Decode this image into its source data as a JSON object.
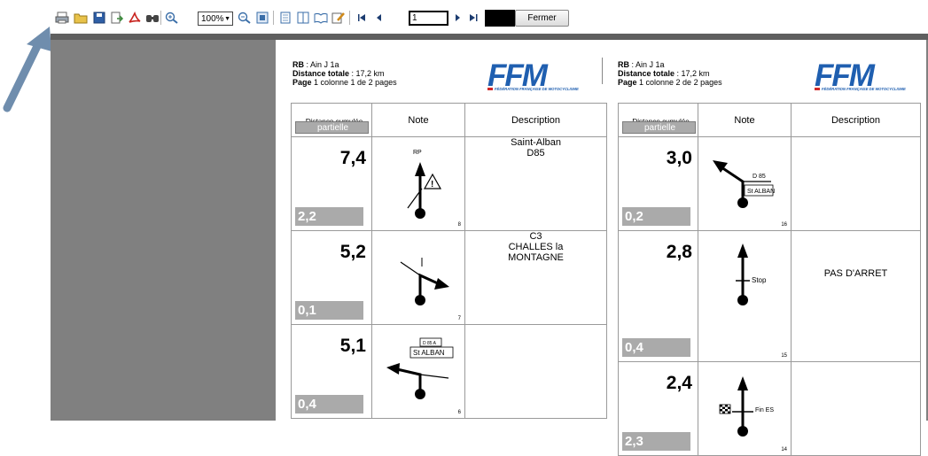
{
  "toolbar": {
    "icons": [
      "print-icon",
      "open-folder-icon",
      "save-icon",
      "export-icon",
      "pdf-icon",
      "find-icon",
      "zoom-in-icon",
      "zoom-out-icon",
      "full-page-icon",
      "single-page-icon",
      "multi-page-icon",
      "book-view-icon",
      "edit-icon",
      "first-page-icon",
      "previous-page-icon",
      "next-page-icon",
      "last-page-icon"
    ],
    "zoom_value": "100%",
    "page_input": "1",
    "close_label": "Fermer"
  },
  "pages": [
    {
      "rb_label": "RB",
      "rb_value": " : Ain J 1a",
      "distance_label": "Distance totale",
      "distance_value": " : 17,2 km",
      "page_label": "Page",
      "page_value": " 1 colonne 1 de 2 pages",
      "logo_text": "FFM",
      "logo_caption": "FÉDÉRATION FRANÇAISE DE MOTOCYCLISME",
      "columns": {
        "distance_line1": "Distance",
        "distance_line1b": "cumulée",
        "partial": "partielle",
        "note": "Note",
        "description": "Description"
      },
      "rows": [
        {
          "cumul": "7,4",
          "partial": "2,2",
          "number": "8",
          "note_label": "RP",
          "description": "Saint-Alban\nD85"
        },
        {
          "cumul": "5,2",
          "partial": "0,1",
          "number": "7",
          "note_label": "",
          "description": "C3\nCHALLES la\nMONTAGNE"
        },
        {
          "cumul": "5,1",
          "partial": "0,4",
          "number": "6",
          "note_label": "St ALBAN",
          "note_label_top": "D 85 A",
          "description": ""
        }
      ]
    },
    {
      "rb_label": "RB",
      "rb_value": " : Ain J 1a",
      "distance_label": "Distance totale",
      "distance_value": " : 17,2 km",
      "page_label": "Page",
      "page_value": " 1 colonne 2 de 2 pages",
      "logo_text": "FFM",
      "logo_caption": "FÉDÉRATION FRANÇAISE DE MOTOCYCLISME",
      "columns": {
        "distance_line1": "Distance",
        "distance_line1b": "cumulée",
        "partial": "partielle",
        "note": "Note",
        "description": "Description"
      },
      "rows": [
        {
          "cumul": "3,0",
          "partial": "0,2",
          "number": "16",
          "note_label": "D 85",
          "note_label2": "St ALBAN",
          "description": ""
        },
        {
          "cumul": "2,8",
          "partial": "0,4",
          "number": "15",
          "note_label": "Stop",
          "description": "PAS  D'ARRET"
        },
        {
          "cumul": "2,4",
          "partial": "2,3",
          "number": "14",
          "note_label": "Fin ES",
          "description": ""
        }
      ]
    }
  ],
  "colors": {
    "viewer_bg": "#808080",
    "partial_box": "#aaaaaa",
    "logo_blue": "#1f5fb0",
    "arrow": "#6f8dad"
  }
}
